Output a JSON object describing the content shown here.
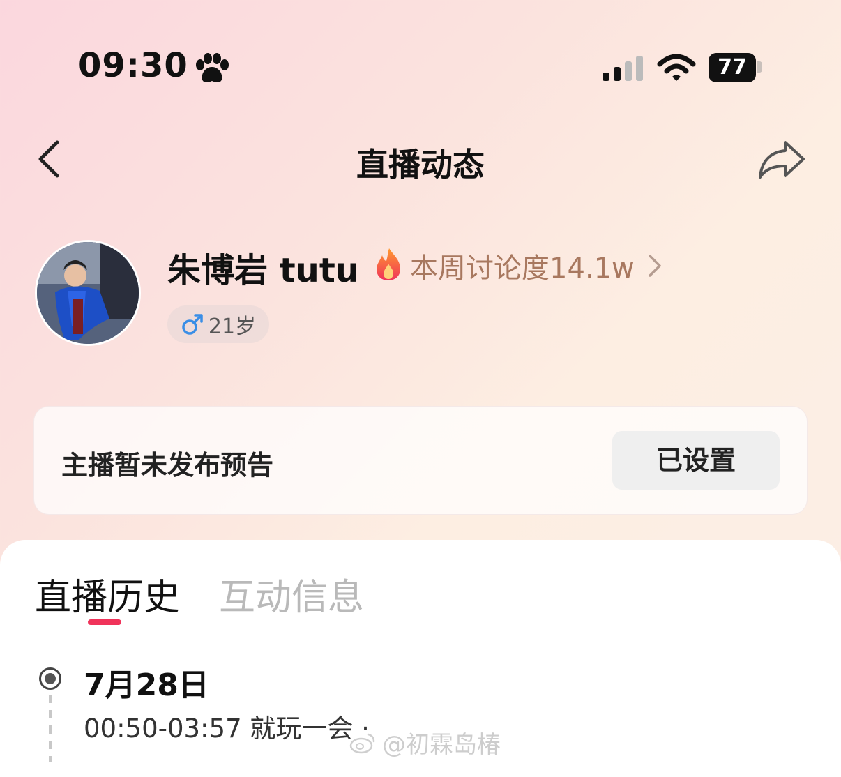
{
  "status_bar": {
    "time": "09:30",
    "paw_icon": "paw-icon",
    "battery": "77"
  },
  "nav": {
    "title": "直播动态",
    "back_icon": "chevron-left-icon",
    "share_icon": "share-arrow-icon"
  },
  "profile": {
    "name": "朱博岩 tutu",
    "heat_label": "本周讨论度14.1w",
    "gender_symbol": "♂",
    "age": "21岁"
  },
  "notice": {
    "text": "主播暂未发布预告",
    "button": "已设置"
  },
  "tabs": [
    {
      "label": "直播历史",
      "active": true
    },
    {
      "label": "互动信息",
      "active": false
    }
  ],
  "history": [
    {
      "date": "7月28日",
      "record": "00:50-03:57 就玩一会 ·"
    }
  ],
  "watermark": "@初霖岛椿",
  "colors": {
    "accent": "#f0335a",
    "heat_text": "#a8785f",
    "male_blue": "#3a8ee6"
  }
}
